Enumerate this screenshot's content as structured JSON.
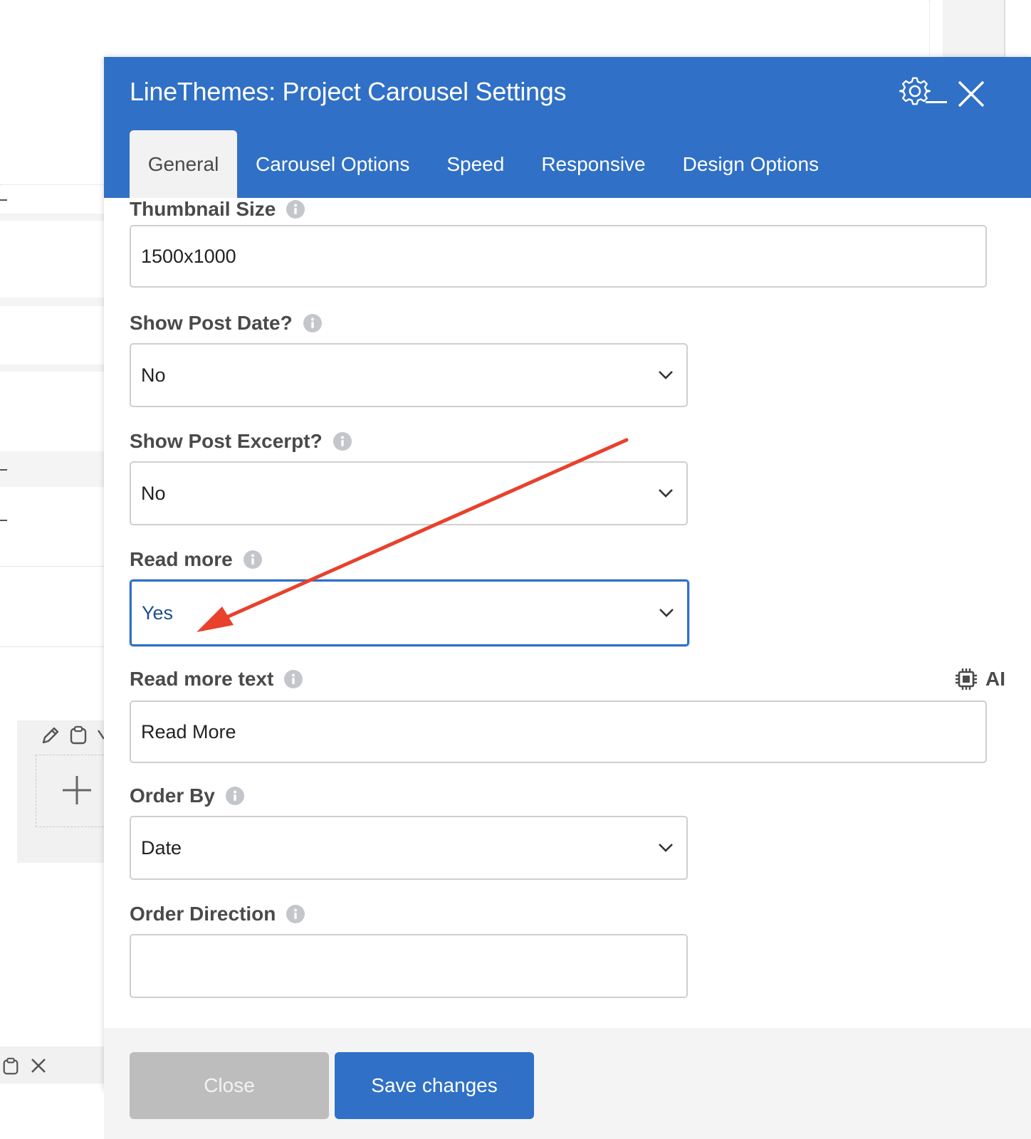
{
  "modal": {
    "title": "LineThemes: Project Carousel Settings",
    "header_color": "#3070c6",
    "tabs": [
      {
        "label": "General",
        "active": true
      },
      {
        "label": "Carousel Options",
        "active": false
      },
      {
        "label": "Speed",
        "active": false
      },
      {
        "label": "Responsive",
        "active": false
      },
      {
        "label": "Design Options",
        "active": false
      }
    ],
    "header_icons": [
      "gear-icon",
      "minimize-icon",
      "close-icon"
    ]
  },
  "fields": {
    "thumbnail_size": {
      "label": "Thumbnail Size",
      "value": "1500x1000"
    },
    "show_post_date": {
      "label": "Show Post Date?",
      "value": "No"
    },
    "show_post_excerpt": {
      "label": "Show Post Excerpt?",
      "value": "No"
    },
    "read_more": {
      "label": "Read more",
      "value": "Yes"
    },
    "read_more_text": {
      "label": "Read more text",
      "value": "Read More",
      "ai_label": "AI"
    },
    "order_by": {
      "label": "Order By",
      "value": "Date"
    },
    "order_direction": {
      "label": "Order Direction",
      "value": ""
    }
  },
  "footer": {
    "close_label": "Close",
    "save_label": "Save changes"
  },
  "annotation": {
    "type": "arrow",
    "color": "#e8412c",
    "points_to": "read-more-select"
  }
}
